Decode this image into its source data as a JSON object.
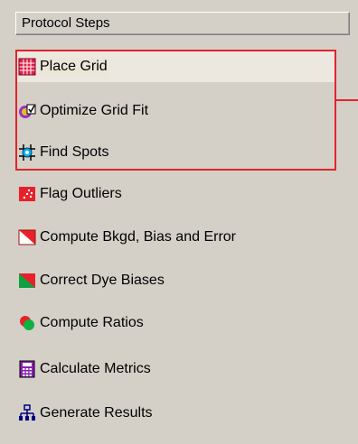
{
  "panel": {
    "title": "Protocol Steps"
  },
  "steps": [
    {
      "label": "Place Grid",
      "icon": "place-grid-icon"
    },
    {
      "label": "Optimize Grid Fit",
      "icon": "optimize-grid-fit-icon"
    },
    {
      "label": "Find Spots",
      "icon": "find-spots-icon"
    },
    {
      "label": "Flag Outliers",
      "icon": "flag-outliers-icon"
    },
    {
      "label": "Compute Bkgd, Bias and Error",
      "icon": "compute-bkgd-icon"
    },
    {
      "label": "Correct Dye Biases",
      "icon": "correct-dye-biases-icon"
    },
    {
      "label": "Compute Ratios",
      "icon": "compute-ratios-icon"
    },
    {
      "label": "Calculate Metrics",
      "icon": "calculate-metrics-icon"
    },
    {
      "label": "Generate Results",
      "icon": "generate-results-icon"
    }
  ],
  "colors": {
    "highlight": "#e3242b",
    "panel_bg": "#d4d0c8"
  }
}
